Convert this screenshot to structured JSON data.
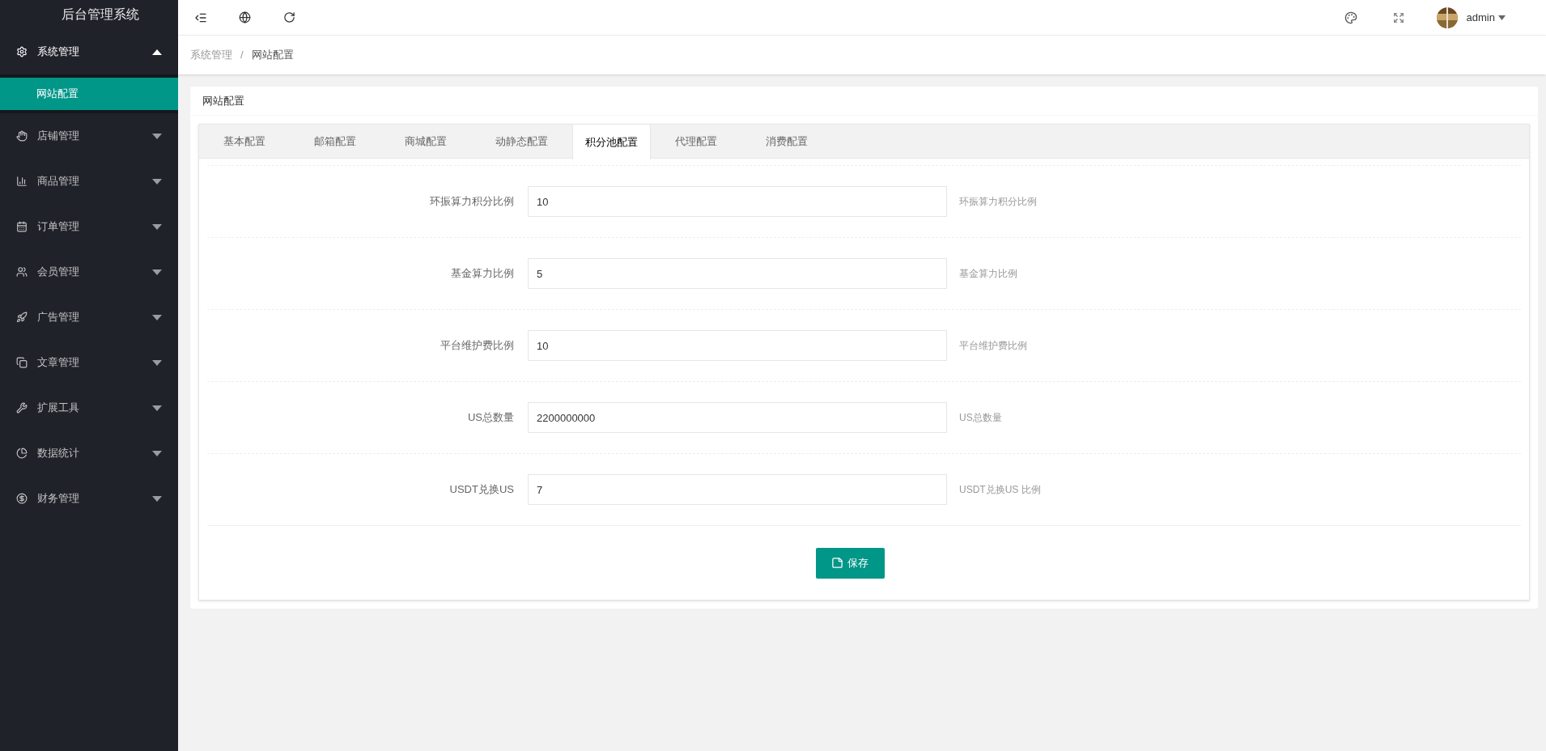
{
  "sidebar": {
    "title": "后台管理系统",
    "items": [
      {
        "label": "系统管理",
        "expanded": true,
        "children": [
          {
            "label": "网站配置",
            "selected": true
          }
        ]
      },
      {
        "label": "店铺管理",
        "expanded": false
      },
      {
        "label": "商品管理",
        "expanded": false
      },
      {
        "label": "订单管理",
        "expanded": false
      },
      {
        "label": "会员管理",
        "expanded": false
      },
      {
        "label": "广告管理",
        "expanded": false
      },
      {
        "label": "文章管理",
        "expanded": false
      },
      {
        "label": "扩展工具",
        "expanded": false
      },
      {
        "label": "数据统计",
        "expanded": false
      },
      {
        "label": "财务管理",
        "expanded": false
      }
    ]
  },
  "topbar": {
    "user": "admin"
  },
  "breadcrumb": {
    "items": [
      "系统管理",
      "网站配置"
    ],
    "separator": "/"
  },
  "card": {
    "title": "网站配置",
    "tabs": [
      {
        "label": "基本配置",
        "selected": false
      },
      {
        "label": "邮箱配置",
        "selected": false
      },
      {
        "label": "商城配置",
        "selected": false
      },
      {
        "label": "动静态配置",
        "selected": false
      },
      {
        "label": "积分池配置",
        "selected": true
      },
      {
        "label": "代理配置",
        "selected": false
      },
      {
        "label": "消费配置",
        "selected": false
      }
    ],
    "fields": [
      {
        "label": "环振算力积分比例",
        "value": "10",
        "help": "环振算力积分比例"
      },
      {
        "label": "基金算力比例",
        "value": "5",
        "help": "基金算力比例"
      },
      {
        "label": "平台维护费比例",
        "value": "10",
        "help": "平台维护费比例"
      },
      {
        "label": "US总数量",
        "value": "2200000000",
        "help": "US总数量"
      },
      {
        "label": "USDT兑换US",
        "value": "7",
        "help": "USDT兑换US 比例"
      }
    ],
    "save_button": "保存"
  }
}
